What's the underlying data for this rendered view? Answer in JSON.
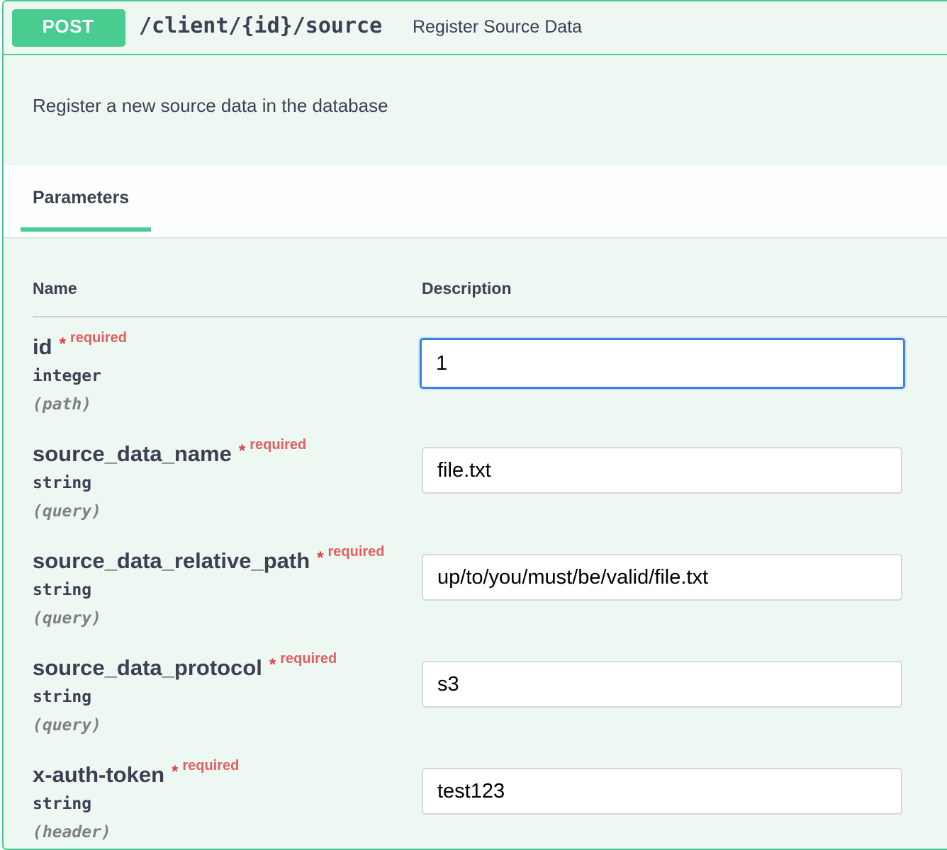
{
  "operation": {
    "method": "POST",
    "path": "/client/{id}/source",
    "summary": "Register Source Data",
    "description": "Register a new source data in the database"
  },
  "tabs": {
    "parameters_label": "Parameters"
  },
  "table": {
    "name_header": "Name",
    "description_header": "Description"
  },
  "params": [
    {
      "name": "id",
      "star": "*",
      "required": "required",
      "type": "integer",
      "in": "(path)",
      "value": "1"
    },
    {
      "name": "source_data_name",
      "star": "*",
      "required": "required",
      "type": "string",
      "in": "(query)",
      "value": "file.txt"
    },
    {
      "name": "source_data_relative_path",
      "star": "*",
      "required": "required",
      "type": "string",
      "in": "(query)",
      "value": "up/to/you/must/be/valid/file.txt"
    },
    {
      "name": "source_data_protocol",
      "star": "*",
      "required": "required",
      "type": "string",
      "in": "(query)",
      "value": "s3"
    },
    {
      "name": "x-auth-token",
      "star": "*",
      "required": "required",
      "type": "string",
      "in": "(header)",
      "value": "test123"
    }
  ],
  "colors": {
    "post_green": "#49cc90",
    "block_background": "#edf8f3",
    "required_red": "#e06060",
    "focus_blue": "#3b82e6"
  }
}
